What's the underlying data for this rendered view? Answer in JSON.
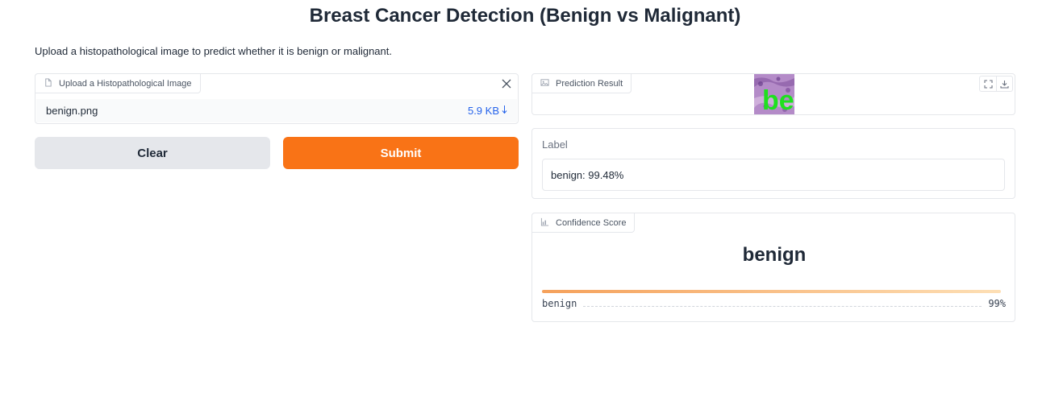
{
  "page": {
    "title": "Breast Cancer Detection (Benign vs Malignant)",
    "description": "Upload a histopathological image to predict whether it is benign or malignant."
  },
  "upload": {
    "label": "Upload a Histopathological Image",
    "file_name": "benign.png",
    "file_size": "5.9 KB",
    "icons": {
      "label_icon": "file-icon",
      "close": "close-icon",
      "download": "download-arrow-icon"
    }
  },
  "actions": {
    "clear_label": "Clear",
    "submit_label": "Submit",
    "submit_color": "#f97316",
    "clear_color": "#e5e7eb"
  },
  "prediction": {
    "label": "Prediction Result",
    "overlay_text": "be",
    "icons": {
      "label_icon": "image-icon",
      "fullscreen": "fullscreen-icon",
      "download": "download-icon"
    }
  },
  "label_output": {
    "label": "Label",
    "value": "benign: 99.48%"
  },
  "confidence": {
    "label": "Confidence Score",
    "top_class": "benign",
    "items": [
      {
        "name": "benign",
        "percent_text": "99%",
        "value": 0.9948
      }
    ],
    "icon": "bar-chart-icon"
  }
}
